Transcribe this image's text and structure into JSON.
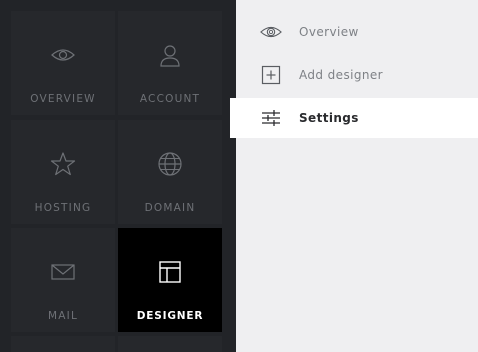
{
  "tiles": [
    {
      "label": "OVERVIEW",
      "icon": "eye-icon"
    },
    {
      "label": "ACCOUNT",
      "icon": "user-icon"
    },
    {
      "label": "HOSTING",
      "icon": "star-icon"
    },
    {
      "label": "DOMAIN",
      "icon": "globe-icon"
    },
    {
      "label": "MAIL",
      "icon": "envelope-icon"
    },
    {
      "label": "DESIGNER",
      "icon": "layout-icon",
      "active": true
    }
  ],
  "submenu": {
    "items": [
      {
        "label": "Overview",
        "icon": "eye-icon"
      },
      {
        "label": "Add designer",
        "icon": "plus-square-icon"
      },
      {
        "label": "Settings",
        "icon": "sliders-icon",
        "selected": true
      }
    ]
  },
  "colors": {
    "left_bg": "#222428",
    "tile_bg": "#26282c",
    "active_tile_bg": "#000000",
    "right_bg": "#efeff1",
    "selected_bg": "#ffffff"
  }
}
